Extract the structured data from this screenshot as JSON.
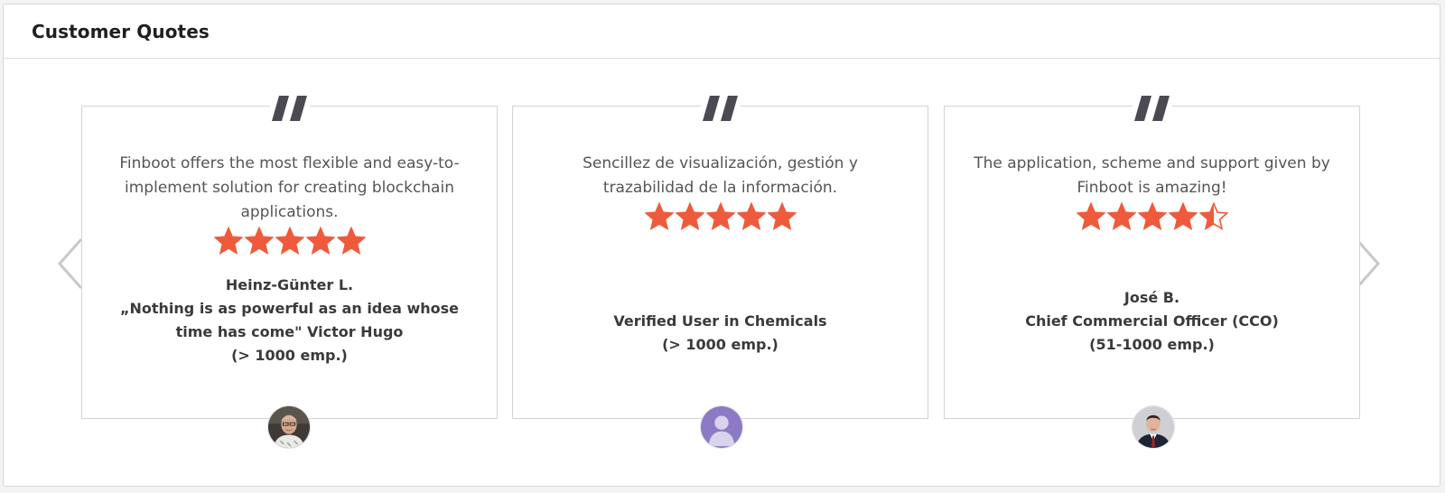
{
  "panel": {
    "title": "Customer Quotes"
  },
  "colors": {
    "star": "#ef5a3c",
    "quote_mark": "#4a4a52",
    "arrow": "#c8c8c8"
  },
  "testimonials": [
    {
      "quote": "Finboot offers the most flexible and easy-to-implement solution for creating blockchain applications.",
      "rating": 5,
      "author_lines": [
        "Heinz-Günter L.",
        "„Nothing is as powerful as an idea whose time has come\" Victor Hugo",
        "(> 1000 emp.)"
      ],
      "avatar": "person-photo-avatar"
    },
    {
      "quote": "Sencillez de visualización, gestión y trazabilidad de la información.",
      "rating": 5,
      "author_lines": [
        "Verified User in Chemicals",
        "(> 1000 emp.)"
      ],
      "avatar": "generic-user-avatar"
    },
    {
      "quote": "The application, scheme and support given by Finboot is amazing!",
      "rating": 4.5,
      "author_lines": [
        "José B.",
        "Chief Commercial Officer (CCO)",
        "(51-1000 emp.)"
      ],
      "avatar": "person-photo-avatar"
    }
  ]
}
